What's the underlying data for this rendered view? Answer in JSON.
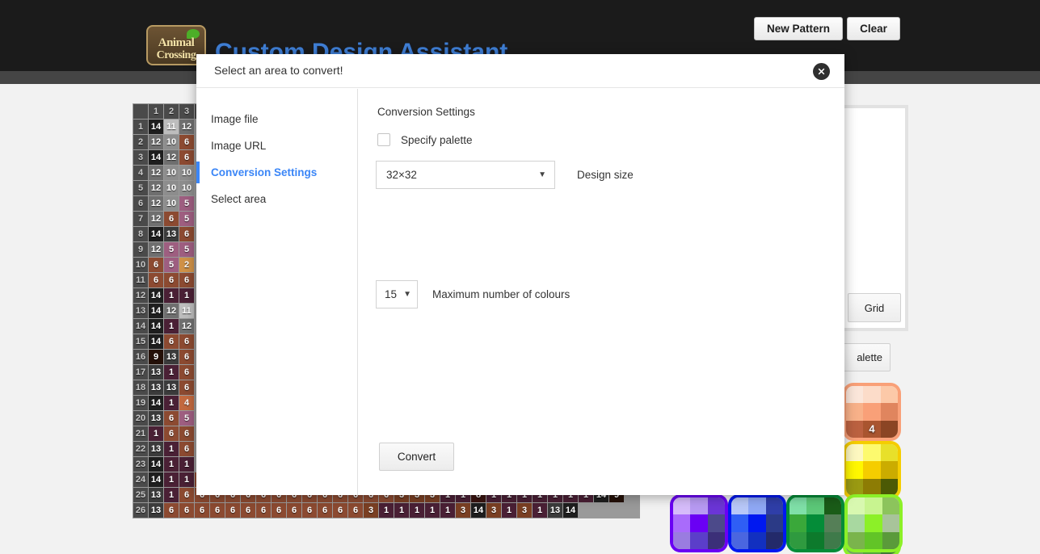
{
  "header": {
    "logo_line1": "Animal",
    "logo_line2": "Crossing",
    "site_title": "Custom Design Assistant",
    "new_pattern_label": "New Pattern",
    "clear_label": "Clear",
    "bg_color": "#1b1b1b",
    "title_color": "#3f7fd6"
  },
  "canvas_panel": {
    "grid_button_label": "Grid",
    "palette_button_label": "alette"
  },
  "modal": {
    "title": "Select an area to convert!",
    "close_icon": "close-icon",
    "accent_color": "#3b86f7",
    "sidebar": [
      {
        "label": "Image file",
        "active": false
      },
      {
        "label": "Image URL",
        "active": false
      },
      {
        "label": "Conversion Settings",
        "active": true
      },
      {
        "label": "Select area",
        "active": false
      }
    ],
    "settings": {
      "heading": "Conversion Settings",
      "specify_palette_label": "Specify palette",
      "specify_palette_checked": false,
      "design_size_value": "32×32",
      "design_size_label": "Design size",
      "max_colours_value": "15",
      "max_colours_label": "Maximum number of colours",
      "caret_icon": "chevron-down-icon"
    },
    "convert_label": "Convert"
  },
  "pixel_grid": {
    "col_headers": [
      "1",
      "2",
      "3"
    ],
    "row_headers": [
      "1",
      "2",
      "3",
      "4",
      "5",
      "6",
      "7",
      "8",
      "9",
      "10",
      "11",
      "12",
      "13",
      "14",
      "15",
      "16",
      "17",
      "18",
      "19",
      "20",
      "21",
      "22",
      "23",
      "24",
      "25",
      "26"
    ],
    "palette_colors": {
      "1": "#4a2035",
      "2": "#cf9147",
      "3": "#7a3f23",
      "4": "#c2693f",
      "5": "#9e5e80",
      "6": "#8c4a31",
      "8": "#3a1410",
      "9": "#241008",
      "10": "#8d8d8d",
      "11": "#bdbdbd",
      "12": "#6f6f6f",
      "13": "#3b3b3b",
      "14": "#1e1e1e"
    },
    "rows": [
      [
        "14",
        "11",
        "12"
      ],
      [
        "12",
        "10",
        "6"
      ],
      [
        "14",
        "12",
        "6"
      ],
      [
        "12",
        "10",
        "10"
      ],
      [
        "12",
        "10",
        "10"
      ],
      [
        "12",
        "10",
        "5"
      ],
      [
        "12",
        "6",
        "5"
      ],
      [
        "14",
        "13",
        "6"
      ],
      [
        "12",
        "5",
        "5"
      ],
      [
        "6",
        "5",
        "2"
      ],
      [
        "6",
        "6",
        "6"
      ],
      [
        "14",
        "1",
        "1"
      ],
      [
        "14",
        "12",
        "11"
      ],
      [
        "14",
        "1",
        "12"
      ],
      [
        "14",
        "6",
        "6"
      ],
      [
        "9",
        "13",
        "6"
      ],
      [
        "13",
        "1",
        "6"
      ],
      [
        "13",
        "13",
        "6"
      ],
      [
        "14",
        "1",
        "4"
      ],
      [
        "13",
        "6",
        "5"
      ],
      [
        "1",
        "6",
        "6"
      ],
      [
        "13",
        "1",
        "6"
      ],
      [
        "14",
        "1",
        "1"
      ],
      [
        "14",
        "1",
        "1",
        "6",
        "6",
        "6",
        "6",
        "6",
        "6",
        "6",
        "6",
        "6",
        "6",
        "6",
        "6",
        "6",
        "6",
        "3",
        "1",
        "1",
        "1",
        "13",
        "1",
        "3",
        "3",
        "1",
        "3",
        "1",
        "1",
        "1",
        "14",
        "9"
      ],
      [
        "13",
        "1",
        "6",
        "6",
        "6",
        "6",
        "6",
        "6",
        "6",
        "6",
        "6",
        "6",
        "6",
        "6",
        "6",
        "6",
        "3",
        "3",
        "3",
        "1",
        "1",
        "8",
        "1",
        "1",
        "1",
        "1",
        "1",
        "1",
        "1",
        "14",
        "9"
      ],
      [
        "13",
        "6",
        "6",
        "6",
        "6",
        "6",
        "6",
        "6",
        "6",
        "6",
        "6",
        "6",
        "6",
        "6",
        "3",
        "1",
        "1",
        "1",
        "1",
        "1",
        "3",
        "14",
        "3",
        "1",
        "3",
        "1",
        "13",
        "14"
      ]
    ]
  },
  "swatches_column": [
    {
      "name": "peach",
      "number": "4",
      "shades": [
        "#fbe6da",
        "#fcdcc9",
        "#fcc9a8",
        "#f8b189",
        "#f9a078",
        "#e0855e",
        "#bb6140",
        "#a9552f",
        "#8b4524"
      ]
    },
    {
      "name": "yellow",
      "number": "",
      "shades": [
        "#fdf8c0",
        "#fdfa6e",
        "#e8e02a",
        "#fff700",
        "#f5cd00",
        "#cbac00",
        "#9a9a12",
        "#8d7c04",
        "#4c5a05"
      ]
    },
    {
      "name": "green",
      "number": "",
      "shades": [
        "#d6f8ba",
        "#c4f78f",
        "#8cb85c",
        "#a8d8a2",
        "#8cf028",
        "#b0c5a7",
        "#6fa85d",
        "#52a83c",
        "#3e7a36"
      ]
    }
  ],
  "swatches_row": [
    {
      "name": "purple",
      "number": "",
      "shades": [
        "#d6bcfa",
        "#b79af2",
        "#6b35d6",
        "#a96bfb",
        "#6a00f4",
        "#4c4a8a",
        "#9a7ce0",
        "#5b3ec9",
        "#3b2f78"
      ]
    },
    {
      "name": "blue",
      "number": "",
      "shades": [
        "#b8c8f8",
        "#8fa8f5",
        "#2f3ea8",
        "#2f5ef5",
        "#0018f0",
        "#2b3a86",
        "#4a66e0",
        "#1230c0",
        "#232a6a"
      ]
    },
    {
      "name": "dark-green",
      "number": "",
      "shades": [
        "#7fe0a8",
        "#5cc878",
        "#1a5c18",
        "#3aa83a",
        "#048c38",
        "#557f57",
        "#2f9a3f",
        "#0d7a2c",
        "#3f7a4a"
      ]
    },
    {
      "name": "lime",
      "number": "",
      "shades": [
        "#d8f8b0",
        "#c8f490",
        "#8cc45c",
        "#a8d8a0",
        "#8cf028",
        "#a8c49a",
        "#7ab44c",
        "#62c427",
        "#5a9a3a"
      ]
    }
  ]
}
